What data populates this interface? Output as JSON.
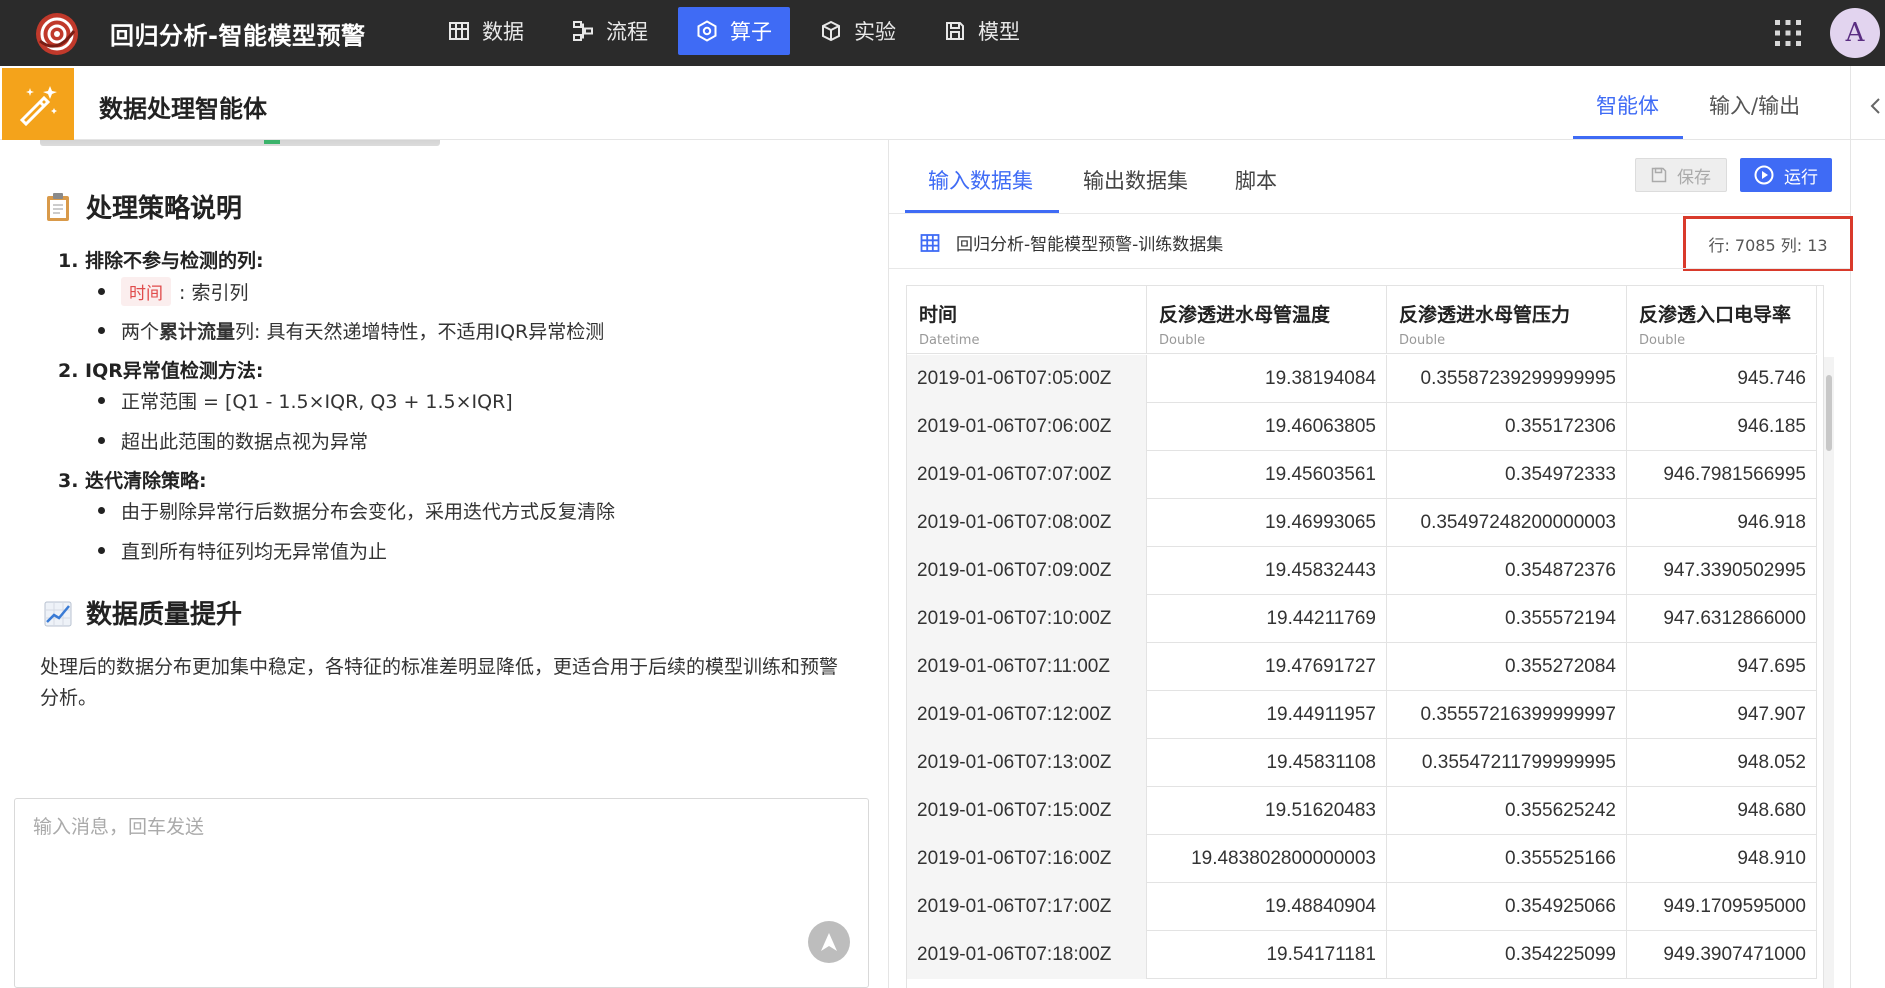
{
  "app": {
    "title": "回归分析-智能模型预警",
    "avatar_letter": "A",
    "accent_color": "#3f6bf5",
    "brand_color": "#c0392b"
  },
  "nav": [
    {
      "label": "数据",
      "icon": "table-icon",
      "active": false
    },
    {
      "label": "流程",
      "icon": "flow-icon",
      "active": false
    },
    {
      "label": "算子",
      "icon": "operator-icon",
      "active": true
    },
    {
      "label": "实验",
      "icon": "cube-icon",
      "active": false
    },
    {
      "label": "模型",
      "icon": "save-model-icon",
      "active": false
    }
  ],
  "subheader": {
    "title": "数据处理智能体",
    "tabs": [
      {
        "label": "智能体",
        "active": true
      },
      {
        "label": "输入/输出",
        "active": false
      }
    ]
  },
  "chat": {
    "strategy_heading": "处理策略说明",
    "items": [
      {
        "title": "1. 排除不参与检测的列:",
        "bullets": [
          {
            "tag": "时间",
            "text": ": 索引列"
          },
          {
            "pre": "两个",
            "strong": "累计流量",
            "text": "列: 具有天然递增特性，不适用IQR异常检测"
          }
        ]
      },
      {
        "title": "2. IQR异常值检测方法:",
        "bullets": [
          {
            "text": "正常范围 = [Q1 - 1.5×IQR, Q3 + 1.5×IQR]"
          },
          {
            "text": "超出此范围的数据点视为异常"
          }
        ]
      },
      {
        "title": "3. 迭代清除策略:",
        "bullets": [
          {
            "text": "由于剔除异常行后数据分布会变化，采用迭代方式反复清除"
          },
          {
            "text": "直到所有特征列均无异常值为止"
          }
        ]
      }
    ],
    "quality_heading": "数据质量提升",
    "quality_text": "处理后的数据分布更加集中稳定，各特征的标准差明显降低，更适合用于后续的模型训练和预警分析。",
    "input_placeholder": "输入消息，回车发送"
  },
  "data_panel": {
    "tabs": [
      {
        "label": "输入数据集",
        "active": true
      },
      {
        "label": "输出数据集",
        "active": false
      },
      {
        "label": "脚本",
        "active": false
      }
    ],
    "save_label": "保存",
    "run_label": "运行",
    "dataset_name": "回归分析-智能模型预警-训练数据集",
    "row_col": "行: 7085 列: 13",
    "columns": [
      {
        "name": "时间",
        "type": "Datetime"
      },
      {
        "name": "反渗透进水母管温度",
        "type": "Double"
      },
      {
        "name": "反渗透进水母管压力",
        "type": "Double"
      },
      {
        "name": "反渗透入口电导率",
        "type": "Double"
      }
    ],
    "rows": [
      [
        "2019-01-06T07:05:00Z",
        "19.38194084",
        "0.35587239299999995",
        "945.746"
      ],
      [
        "2019-01-06T07:06:00Z",
        "19.46063805",
        "0.355172306",
        "946.185"
      ],
      [
        "2019-01-06T07:07:00Z",
        "19.45603561",
        "0.354972333",
        "946.7981566995"
      ],
      [
        "2019-01-06T07:08:00Z",
        "19.46993065",
        "0.35497248200000003",
        "946.918"
      ],
      [
        "2019-01-06T07:09:00Z",
        "19.45832443",
        "0.354872376",
        "947.3390502995"
      ],
      [
        "2019-01-06T07:10:00Z",
        "19.44211769",
        "0.355572194",
        "947.6312866000"
      ],
      [
        "2019-01-06T07:11:00Z",
        "19.47691727",
        "0.355272084",
        "947.695"
      ],
      [
        "2019-01-06T07:12:00Z",
        "19.44911957",
        "0.35557216399999997",
        "947.907"
      ],
      [
        "2019-01-06T07:13:00Z",
        "19.45831108",
        "0.35547211799999995",
        "948.052"
      ],
      [
        "2019-01-06T07:15:00Z",
        "19.51620483",
        "0.355625242",
        "948.680"
      ],
      [
        "2019-01-06T07:16:00Z",
        "19.483802800000003",
        "0.355525166",
        "948.910"
      ],
      [
        "2019-01-06T07:17:00Z",
        "19.48840904",
        "0.354925066",
        "949.1709595000"
      ],
      [
        "2019-01-06T07:18:00Z",
        "19.54171181",
        "0.354225099",
        "949.3907471000"
      ]
    ]
  }
}
